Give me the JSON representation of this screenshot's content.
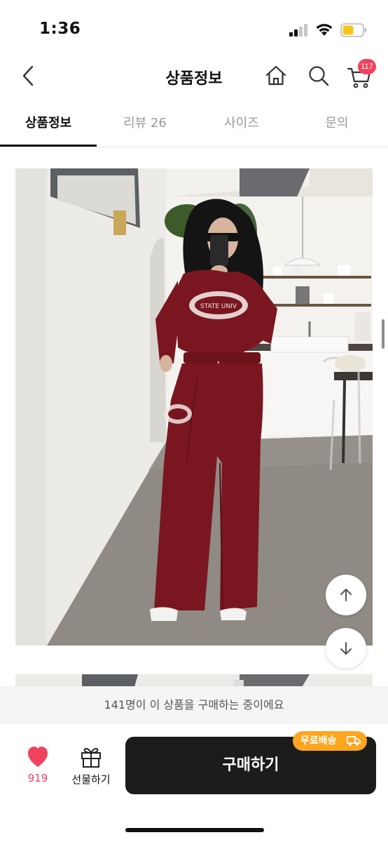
{
  "status": {
    "time": "1:36"
  },
  "header": {
    "title": "상품정보",
    "cart_count": "117"
  },
  "tabs": [
    {
      "label": "상품정보",
      "active": true
    },
    {
      "label": "리뷰 26",
      "active": false
    },
    {
      "label": "사이즈",
      "active": false
    },
    {
      "label": "문의",
      "active": false
    }
  ],
  "photo": {
    "print_text": "STATE UNIV"
  },
  "viewers_text": "141명이 이 상품을 구매하는 중이에요",
  "bottom": {
    "like_count": "919",
    "gift_label": "선물하기",
    "buy_label": "구매하기",
    "shipping_badge": "무료배송"
  },
  "colors": {
    "accent_red": "#f0425f",
    "shipping_orange": "#ffa51e",
    "buy_button": "#1c1c1c",
    "outfit_burgundy": "#7a1620"
  },
  "icons": [
    "back-icon",
    "home-icon",
    "search-icon",
    "cart-icon",
    "heart-icon",
    "gift-icon",
    "arrow-up-icon",
    "arrow-down-icon",
    "truck-icon"
  ]
}
